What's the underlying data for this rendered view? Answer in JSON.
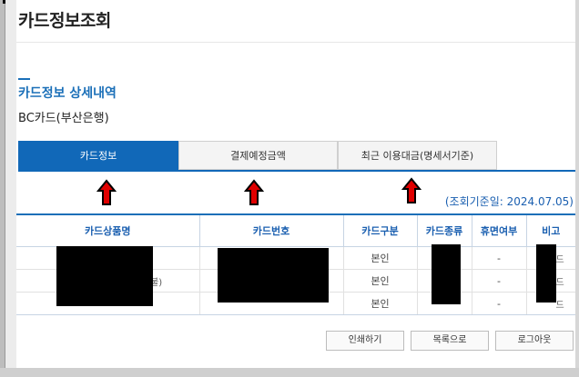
{
  "page": {
    "title": "카드정보조회"
  },
  "section": {
    "title": "카드정보 상세내역",
    "card_company": "BC카드(부산은행)"
  },
  "tabs": [
    {
      "label": "카드정보",
      "active": true
    },
    {
      "label": "결제예정금액",
      "active": false
    },
    {
      "label": "최근 이용대금(명세서기준)",
      "active": false
    }
  ],
  "as_of": "(조회기준일: 2024.07.05)",
  "table": {
    "headers": [
      "카드상품명",
      "카드번호",
      "카드구분",
      "카드종류",
      "휴면여부",
      "비고"
    ],
    "rows": [
      {
        "category": "본인",
        "dormant": "-",
        "note_fragment": "드",
        "name_fragment": ""
      },
      {
        "category": "본인",
        "dormant": "-",
        "note_fragment": "드",
        "name_fragment": "불)"
      },
      {
        "category": "본인",
        "dormant": "-",
        "note_fragment": "드",
        "name_fragment": ""
      }
    ]
  },
  "buttons": {
    "print": "인쇄하기",
    "list": "목록으로",
    "logout": "로그아웃"
  },
  "colors": {
    "accent": "#1168b8",
    "arrow": "#e00000",
    "header_text": "#1a5fb0"
  }
}
